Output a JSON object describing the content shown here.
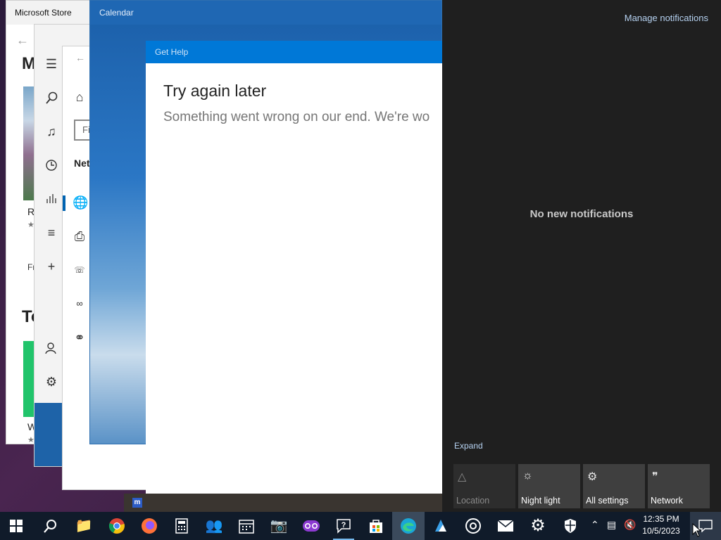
{
  "store": {
    "title": "Microsoft Store",
    "heading_fragment": "M",
    "item1": "R",
    "item1_rating": "★",
    "free_fragment": "Fr",
    "section_fragment": "To",
    "item2": "W",
    "item2_rating": "★"
  },
  "media": {
    "icons": [
      "hamburger-icon",
      "search-icon",
      "music-note-icon",
      "recent-icon",
      "equalizer-icon",
      "playlist-icon",
      "add-icon",
      "account-icon",
      "gear-icon"
    ]
  },
  "settings": {
    "find_placeholder": "Fi",
    "section_fragment": "Net",
    "icons": [
      "home-icon",
      "globe-status-icon",
      "ethernet-icon",
      "dialup-icon",
      "vpn-icon",
      "proxy-globe-icon"
    ]
  },
  "calendar": {
    "title": "Calendar"
  },
  "gethelp": {
    "title": "Get Help",
    "heading": "Try again later",
    "message": "Something went wrong on our end. We're wo"
  },
  "action_center": {
    "manage": "Manage notifications",
    "empty": "No new notifications",
    "expand": "Expand",
    "tiles": [
      {
        "label": "Location",
        "icon": "location-icon",
        "enabled": false
      },
      {
        "label": "Night light",
        "icon": "night-light-icon",
        "enabled": true
      },
      {
        "label": "All settings",
        "icon": "settings-icon",
        "enabled": true
      },
      {
        "label": "Network",
        "icon": "network-icon",
        "enabled": true
      }
    ]
  },
  "taskbar": {
    "time": "12:35 PM",
    "date": "10/5/2023",
    "apps": [
      "start",
      "search",
      "file-explorer",
      "chrome",
      "firefox",
      "calculator",
      "people",
      "calendar",
      "camera",
      "feedback",
      "get-help",
      "store",
      "edge",
      "photos-like",
      "groove",
      "mail",
      "settings",
      "security"
    ]
  },
  "strip_logo": "m"
}
